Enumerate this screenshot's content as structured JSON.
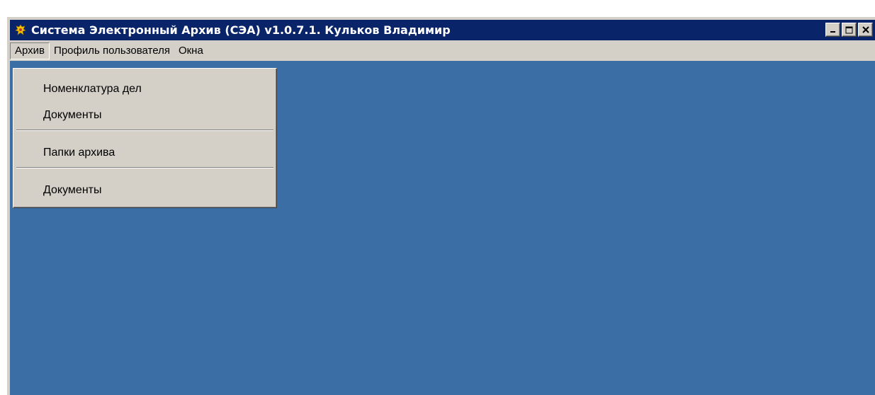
{
  "window": {
    "title": "Система Электронный Архив (СЭА) v1.0.7.1. Кульков Владимир",
    "icon": "coat-of-arms-icon",
    "caption_buttons": {
      "minimize": "minimize-icon",
      "maximize": "maximize-icon",
      "close": "close-icon"
    }
  },
  "menubar": {
    "items": [
      {
        "label": "Архив",
        "active": true
      },
      {
        "label": "Профиль пользователя"
      },
      {
        "label": "Окна"
      }
    ]
  },
  "dropdown": {
    "items": [
      {
        "label": "Номенклатура дел"
      },
      {
        "label": "Документы"
      },
      {
        "separator": true
      },
      {
        "label": "Папки архива"
      },
      {
        "separator": true
      },
      {
        "label": "Документы"
      }
    ]
  },
  "colors": {
    "titlebar": "#0a246a",
    "desktop": "#3a6ea5",
    "chrome": "#d4d0c8"
  }
}
